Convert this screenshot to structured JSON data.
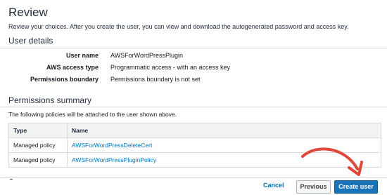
{
  "review": {
    "title": "Review",
    "intro": "Review your choices. After you create the user, you can view and download the autogenerated password and access key."
  },
  "user_details": {
    "heading": "User details",
    "rows": [
      {
        "label": "User name",
        "value": "AWSForWordPressPlugin"
      },
      {
        "label": "AWS access type",
        "value": "Programmatic access - with an access key"
      },
      {
        "label": "Permissions boundary",
        "value": "Permissions boundary is not set"
      }
    ]
  },
  "permissions": {
    "heading": "Permissions summary",
    "note": "The following policies will be attached to the user shown above.",
    "columns": [
      "Type",
      "Name"
    ],
    "rows": [
      {
        "type": "Managed policy",
        "name": "AWSForWordPressDeleteCert"
      },
      {
        "type": "Managed policy",
        "name": "AWSForWordPressPluginPolicy"
      }
    ]
  },
  "footer": {
    "cancel_label": "Cancel",
    "previous_label": "Previous",
    "create_label": "Create user"
  },
  "colors": {
    "primary_button": "#1a73b8",
    "link": "#0073bb",
    "annotation_arrow": "#e0463a"
  },
  "icons": {
    "annotation": "red-curved-arrow-icon"
  }
}
